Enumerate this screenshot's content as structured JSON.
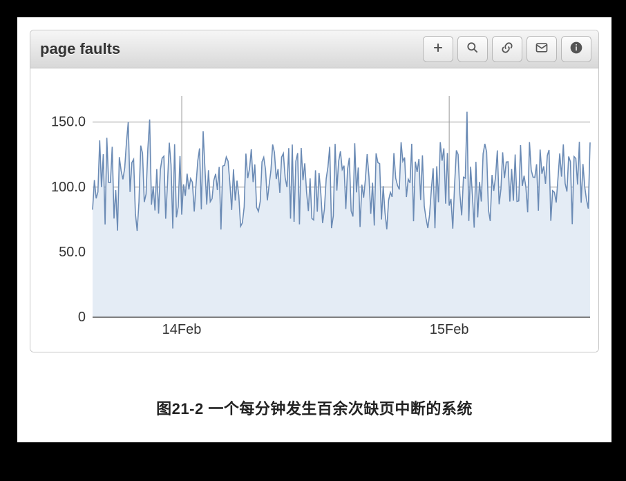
{
  "panel": {
    "title": "page faults",
    "toolbar": [
      {
        "name": "add-button",
        "icon": "plus-icon"
      },
      {
        "name": "zoom-button",
        "icon": "magnifier-icon"
      },
      {
        "name": "link-button",
        "icon": "link-icon"
      },
      {
        "name": "mail-button",
        "icon": "mail-icon"
      },
      {
        "name": "info-button",
        "icon": "info-icon"
      }
    ]
  },
  "caption": "图21-2 一个每分钟发生百余次缺页中断的系统",
  "chart_data": {
    "type": "area",
    "title": "page faults",
    "xlabel": "",
    "ylabel": "",
    "ylim": [
      0,
      170
    ],
    "y_ticks": [
      0,
      50.0,
      100.0,
      150.0
    ],
    "x_ticks": [
      {
        "index": 50,
        "label": "14Feb"
      },
      {
        "index": 200,
        "label": "15Feb"
      }
    ],
    "n_points": 280,
    "mean": 100,
    "amplitude_low": 35,
    "amplitude_high": 55,
    "seed": 42,
    "colors": {
      "line": "#6b8bb5",
      "fill": "#e4ecf5",
      "grid": "#999999"
    }
  }
}
